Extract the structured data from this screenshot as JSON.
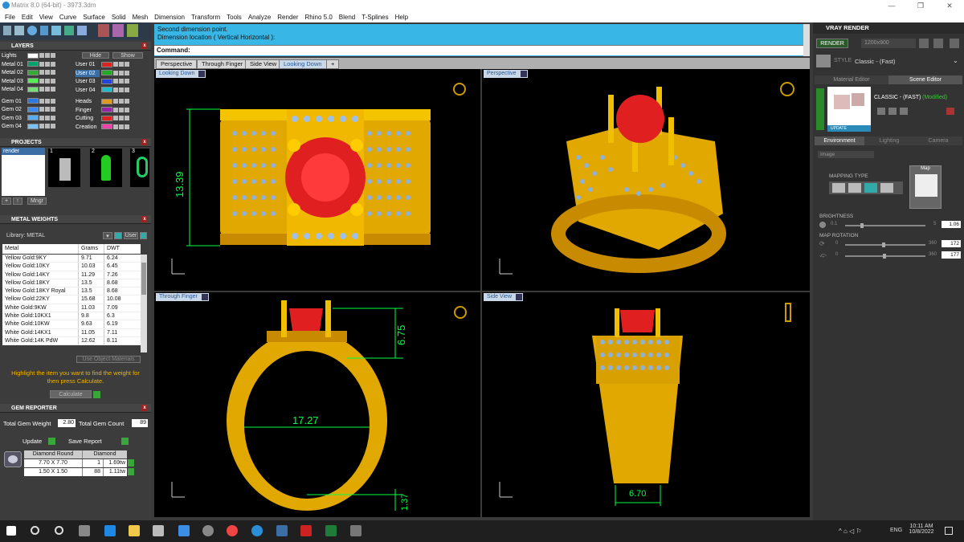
{
  "window": {
    "title": "Matrix 8.0 (64-bit) - 3973.3dm"
  },
  "menu": [
    "File",
    "Edit",
    "View",
    "Curve",
    "Surface",
    "Solid",
    "Mesh",
    "Dimension",
    "Transform",
    "Tools",
    "Analyze",
    "Render",
    "Rhino 5.0",
    "Blend",
    "T-Splines",
    "Help"
  ],
  "layers": {
    "header": "LAYERS",
    "hide_label": "Hide",
    "show_label": "Show",
    "left": [
      {
        "name": "Lights",
        "color": "#ffffff"
      },
      {
        "name": "Metal 01",
        "color": "#00a36c"
      },
      {
        "name": "Metal 02",
        "color": "#33aa33"
      },
      {
        "name": "Metal 03",
        "color": "#55ee55"
      },
      {
        "name": "Metal 04",
        "color": "#77dd77"
      },
      {
        "name": "Gem 01",
        "color": "#2a7ae2"
      },
      {
        "name": "Gem 02",
        "color": "#3b8bf0"
      },
      {
        "name": "Gem 03",
        "color": "#5aaaf0"
      },
      {
        "name": "Gem 04",
        "color": "#7ac0f4"
      }
    ],
    "right": [
      {
        "name": "User 01",
        "color": "#dd2222"
      },
      {
        "name": "User 02",
        "color": "#22aa22",
        "selected": true
      },
      {
        "name": "User 03",
        "color": "#2244dd"
      },
      {
        "name": "User 04",
        "color": "#22bbcc"
      },
      {
        "name": "Heads",
        "color": "#dd9922"
      },
      {
        "name": "Finger",
        "color": "#9922aa"
      },
      {
        "name": "Cutting",
        "color": "#dd2222"
      },
      {
        "name": "Creation",
        "color": "#ee44aa"
      }
    ]
  },
  "projects": {
    "header": "PROJECTS",
    "item": "render",
    "thumbs": [
      "1",
      "2",
      "3"
    ],
    "mngr": "Mngr"
  },
  "metal_weights": {
    "header": "METAL WEIGHTS",
    "library_label": "Library: METAL",
    "user_label": "User",
    "cols": [
      "Metal",
      "Grams",
      "DWT"
    ],
    "rows": [
      [
        "Yellow Gold:9KY",
        "9.71",
        "6.24"
      ],
      [
        "Yellow Gold:10KY",
        "10.03",
        "6.45"
      ],
      [
        "Yellow Gold:14KY",
        "11.29",
        "7.26"
      ],
      [
        "Yellow Gold:18KY",
        "13.5",
        "8.68"
      ],
      [
        "Yellow Gold:18KY Royal",
        "13.5",
        "8.68"
      ],
      [
        "Yellow Gold:22KY",
        "15.68",
        "10.08"
      ],
      [
        "White Gold:9KW",
        "11.03",
        "7.09"
      ],
      [
        "White Gold:10KX1",
        "9.8",
        "6.3"
      ],
      [
        "White Gold:10KW",
        "9.63",
        "6.19"
      ],
      [
        "White Gold:14KX1",
        "11.05",
        "7.11"
      ],
      [
        "White Gold:14K PdW",
        "12.62",
        "8.11"
      ]
    ],
    "use_object": "Use Object Materials",
    "hint": "Highlight the item you want to find the weight for then press Calculate.",
    "calculate": "Calculate"
  },
  "gem_reporter": {
    "header": "GEM REPORTER",
    "total_weight_label": "Total Gem Weight",
    "total_weight": "2.80",
    "total_count_label": "Total Gem Count",
    "total_count": "89",
    "update": "Update",
    "save": "Save Report",
    "cols": [
      "Diamond Round",
      "Diamond"
    ],
    "rows": [
      [
        "7.70 X 7.70",
        "1",
        "1.69tw"
      ],
      [
        "1.50 X 1.50",
        "88",
        "1.11tw"
      ]
    ]
  },
  "command": {
    "line1": "Second dimension point.",
    "line2": "Dimension location ( Vertical  Horizontal ):",
    "label": "Command:"
  },
  "tabs": [
    "Perspective",
    "Through Finger",
    "Side View",
    "Looking Down"
  ],
  "viewports": {
    "tl": {
      "label": "Looking Down",
      "dim": "13.39"
    },
    "tr": {
      "label": "Perspective"
    },
    "bl": {
      "label": "Through Finger",
      "dim1": "6.75",
      "dim2": "17.27",
      "dim3": "1.37"
    },
    "br": {
      "label": "Side View",
      "dim": "6.70"
    }
  },
  "vray": {
    "header": "VRAY RENDER",
    "render_btn": "RENDER",
    "resolution": "1200x900",
    "style_label": "STYLE",
    "style": "Classic - (Fast)",
    "tab_material": "Material Editor",
    "tab_scene": "Scene Editor",
    "preset": "CLASSIC - (FAST)",
    "modified": "(Modified)",
    "update": "UPDATE",
    "env_tabs": [
      "Environment",
      "Lighting",
      "Camera"
    ],
    "env_type": "Image",
    "mapping_type": "MAPPING TYPE",
    "map_label": "Map",
    "brightness_label": "BRIGHTNESS",
    "brightness_min": "0.1",
    "brightness_max": "5",
    "brightness_val": "1.06",
    "brightness_frac": 0.2,
    "map_rotation_label": "MAP ROTATION",
    "rot1_min": "0",
    "rot1_max": "360",
    "rot1_val": "172",
    "rot2_min": "0",
    "rot2_max": "360",
    "rot2_val": "177"
  },
  "taskbar": {
    "time": "10:11 AM",
    "date": "10/8/2022",
    "lang": "ENG"
  }
}
